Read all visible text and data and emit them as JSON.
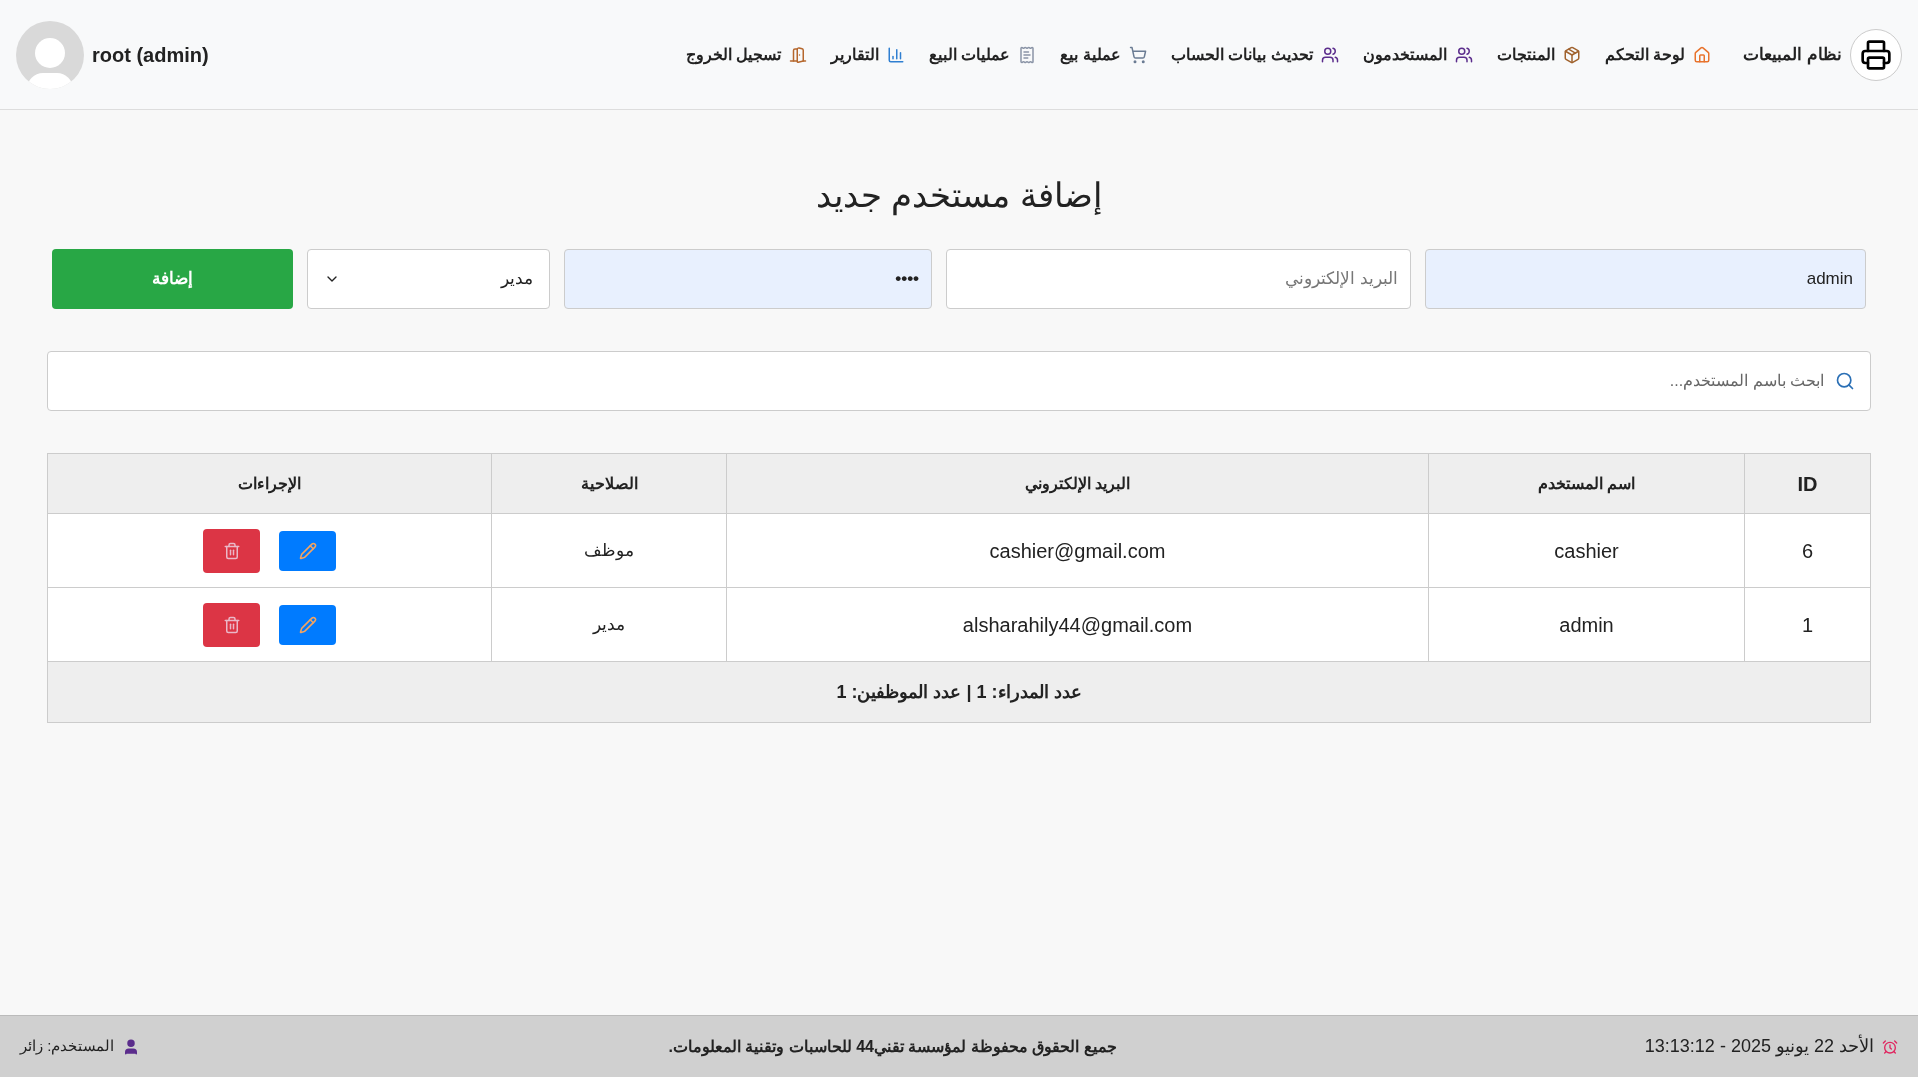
{
  "header": {
    "brand": "نظام المبيعات",
    "nav": [
      {
        "label": "لوحة التحكم",
        "kind": "home"
      },
      {
        "label": "المنتجات",
        "kind": "package"
      },
      {
        "label": "المستخدمون",
        "kind": "users"
      },
      {
        "label": "تحديث بيانات الحساب",
        "kind": "users"
      },
      {
        "label": "عملية بيع",
        "kind": "cart"
      },
      {
        "label": "عمليات البيع",
        "kind": "receipt"
      },
      {
        "label": "التقارير",
        "kind": "chart"
      },
      {
        "label": "تسجيل الخروج",
        "kind": "door"
      }
    ],
    "user": "root (admin)"
  },
  "form": {
    "title": "إضافة مستخدم جديد",
    "username": "admin",
    "email_placeholder": "البريد الإلكتروني",
    "password": "••••",
    "role": "مدير",
    "submit": "إضافة"
  },
  "search": {
    "placeholder": "ابحث باسم المستخدم..."
  },
  "table": {
    "columns": [
      "ID",
      "اسم المستخدم",
      "البريد الإلكتروني",
      "الصلاحية",
      "الإجراءات"
    ],
    "rows": [
      {
        "id": "6",
        "username": "cashier",
        "email": "cashier@gmail.com",
        "role": "موظف"
      },
      {
        "id": "1",
        "username": "admin",
        "email": "alsharahily44@gmail.com",
        "role": "مدير"
      }
    ],
    "summary": "عدد المدراء: 1 | عدد الموظفين: 1"
  },
  "footer": {
    "datetime": "الأحد 22 يونيو 2025 - 13:13:12",
    "copyright": "جميع الحقوق محفوظة لمؤسسة تقني44 للحاسبات وتقنية المعلومات.",
    "user": "المستخدم: زائر"
  }
}
